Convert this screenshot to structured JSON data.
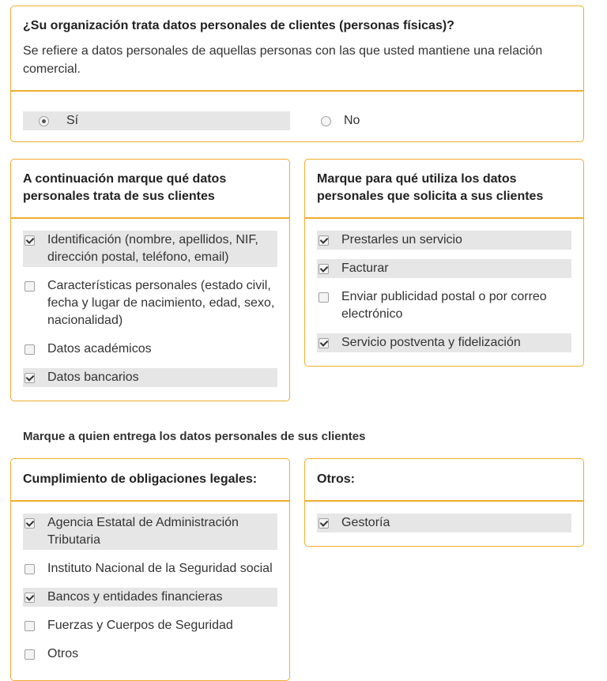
{
  "q1": {
    "title": "¿Su organización trata datos personales de clientes (personas físicas)?",
    "description": "Se refiere a datos personales de aquellas personas con las que usted mantiene una relación comercial.",
    "options": [
      {
        "label": "Sí",
        "selected": true
      },
      {
        "label": "No",
        "selected": false
      }
    ]
  },
  "datos": {
    "title": "A continuación marque qué datos personales trata de sus clientes",
    "items": [
      {
        "label": "Identificación (nombre, apellidos, NIF, dirección postal, teléfono, email)",
        "checked": true
      },
      {
        "label": "Características personales (estado civil, fecha y lugar de nacimiento, edad, sexo, nacionalidad)",
        "checked": false
      },
      {
        "label": "Datos académicos",
        "checked": false
      },
      {
        "label": "Datos bancarios",
        "checked": true
      }
    ]
  },
  "usos": {
    "title": "Marque para qué utiliza los datos personales que solicita a sus clientes",
    "items": [
      {
        "label": "Prestarles un servicio",
        "checked": true
      },
      {
        "label": "Facturar",
        "checked": true
      },
      {
        "label": "Enviar publicidad postal o por correo electrónico",
        "checked": false
      },
      {
        "label": "Servicio postventa y fidelización",
        "checked": true
      }
    ]
  },
  "entrega_heading": "Marque a quien entrega los datos personales de sus clientes",
  "legales": {
    "title": "Cumplimiento de obligaciones legales:",
    "items": [
      {
        "label": "Agencia Estatal de Administración Tributaria",
        "checked": true
      },
      {
        "label": "Instituto Nacional de la Seguridad social",
        "checked": false
      },
      {
        "label": "Bancos y entidades financieras",
        "checked": true
      },
      {
        "label": "Fuerzas y Cuerpos de Seguridad",
        "checked": false
      },
      {
        "label": "Otros",
        "checked": false
      }
    ]
  },
  "otros": {
    "title": "Otros:",
    "items": [
      {
        "label": "Gestoría",
        "checked": true
      }
    ]
  }
}
